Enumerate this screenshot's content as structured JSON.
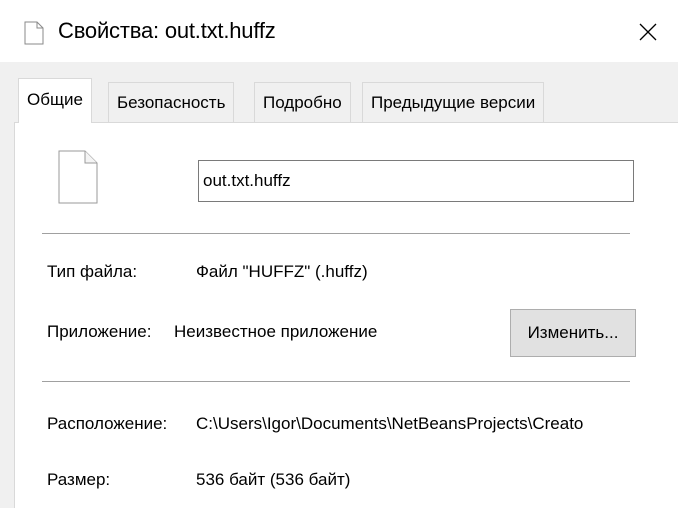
{
  "window": {
    "title": "Свойства: out.txt.huffz",
    "title_icon": "file-icon",
    "close_icon": "close-icon"
  },
  "tabs": [
    {
      "label": "Общие",
      "active": true
    },
    {
      "label": "Безопасность",
      "active": false
    },
    {
      "label": "Подробно",
      "active": false
    },
    {
      "label": "Предыдущие версии",
      "active": false
    }
  ],
  "general": {
    "file_icon": "blank-document-icon",
    "filename_value": "out.txt.huffz",
    "file_type_label": "Тип файла:",
    "file_type_value": "Файл \"HUFFZ\" (.huffz)",
    "app_label": "Приложение:",
    "app_value": "Неизвестное приложение",
    "change_button": "Изменить...",
    "location_label": "Расположение:",
    "location_value": "C:\\Users\\Igor\\Documents\\NetBeansProjects\\Creato",
    "size_label": "Размер:",
    "size_value": "536 байт (536 байт)"
  },
  "colors": {
    "window_bg": "#ffffff",
    "dialog_bg": "#f0f0f0",
    "button_bg": "#e1e1e1",
    "border": "#d9d9d9"
  }
}
